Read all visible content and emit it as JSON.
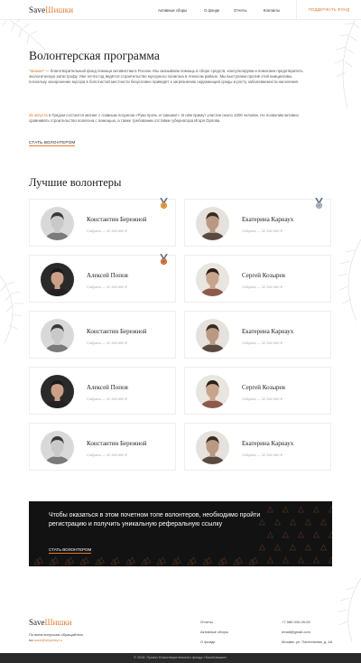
{
  "header": {
    "logo_a": "Save",
    "logo_b": "Шишки",
    "nav": [
      "Активные сборы",
      "О фонде",
      "Отчеты",
      "Контакты"
    ],
    "donate": "ПОДДЕРЖАТЬ ФОНД"
  },
  "intro": {
    "title": "Волонтерская программа",
    "p1_brand": "\"Шишки\"",
    "p1": " — благотворительный фонд помощи активистам в России. Мы оказываем помощь в сборе средств, консультируем и помогаем предотвратить экологическую катастрофу. Уже почти год ведётся строительство мусорного полигона в Апексом районе. Мы выступаем против этой инициативы, поскольку захоронение мусора в болотистой местности безусловно приведёт к загрязнению окружающей среды и росту заболеваемости населения.",
    "p2_date": "26 августа",
    "p2": " в Грядом состоится митинг с главным лозунгом «Руки прочь от Шишек!». В нём примут участие около 1000 человек. Не позволим активно сравнивать строительство полигона с помощью, а также требовании отставки губернатора Игоря Орлова.",
    "cta": "СТАТЬ ВОЛОНТЕРОМ"
  },
  "volunteers": {
    "title": "Лучшие волонтеры",
    "items": [
      {
        "name": "Константин Бережной",
        "raised": "Собрано — 32 350 650 ₽",
        "medal": "gold-medal-icon"
      },
      {
        "name": "Екатерина Карнаух",
        "raised": "Собрано — 32 350 650 ₽",
        "medal": "silver-medal-icon"
      },
      {
        "name": "Алексей Попов",
        "raised": "Собрано — 32 350 650 ₽",
        "medal": "bronze-medal-icon"
      },
      {
        "name": "Сергей Козырев",
        "raised": "Собрано — 32 350 650 ₽",
        "medal": ""
      },
      {
        "name": "Константин Бережной",
        "raised": "Собрано — 32 350 650 ₽",
        "medal": ""
      },
      {
        "name": "Екатерина Карнаух",
        "raised": "Собрано — 32 350 650 ₽",
        "medal": ""
      },
      {
        "name": "Алексей Попов",
        "raised": "Собрано — 32 350 650 ₽",
        "medal": ""
      },
      {
        "name": "Сергей Козырев",
        "raised": "Собрано — 32 350 650 ₽",
        "medal": ""
      },
      {
        "name": "Константин Бережной",
        "raised": "Собрано — 32 350 650 ₽",
        "medal": ""
      },
      {
        "name": "Екатерина Карнаух",
        "raised": "Собрано — 32 350 650 ₽",
        "medal": ""
      }
    ]
  },
  "banner": {
    "text": "Чтобы оказаться в этом почетном топе волонтеров, необходимо пройти регистрацию и получить уникальную реферальную ссылку",
    "cta": "СТАТЬ ВОЛОНТЕРОМ"
  },
  "footer": {
    "logo_a": "Save",
    "logo_b": "Шишки",
    "questions": "По всем вопросам обращайтесь",
    "email_prefix": "на ",
    "email": "save@shyshky.ru",
    "links": [
      "Отчеты",
      "Активные сборы",
      "О фонде"
    ],
    "phone": "+7 985 000-00-00",
    "mail2": "email@gmail.com",
    "address": "Москва, ул. Пантелеева, д. 4А",
    "copyright": "© 2018. Проект Благотворительного фонда «SaveШишки»."
  },
  "colors": {
    "accent": "#e07a2c",
    "banner_bg": "#121212"
  }
}
